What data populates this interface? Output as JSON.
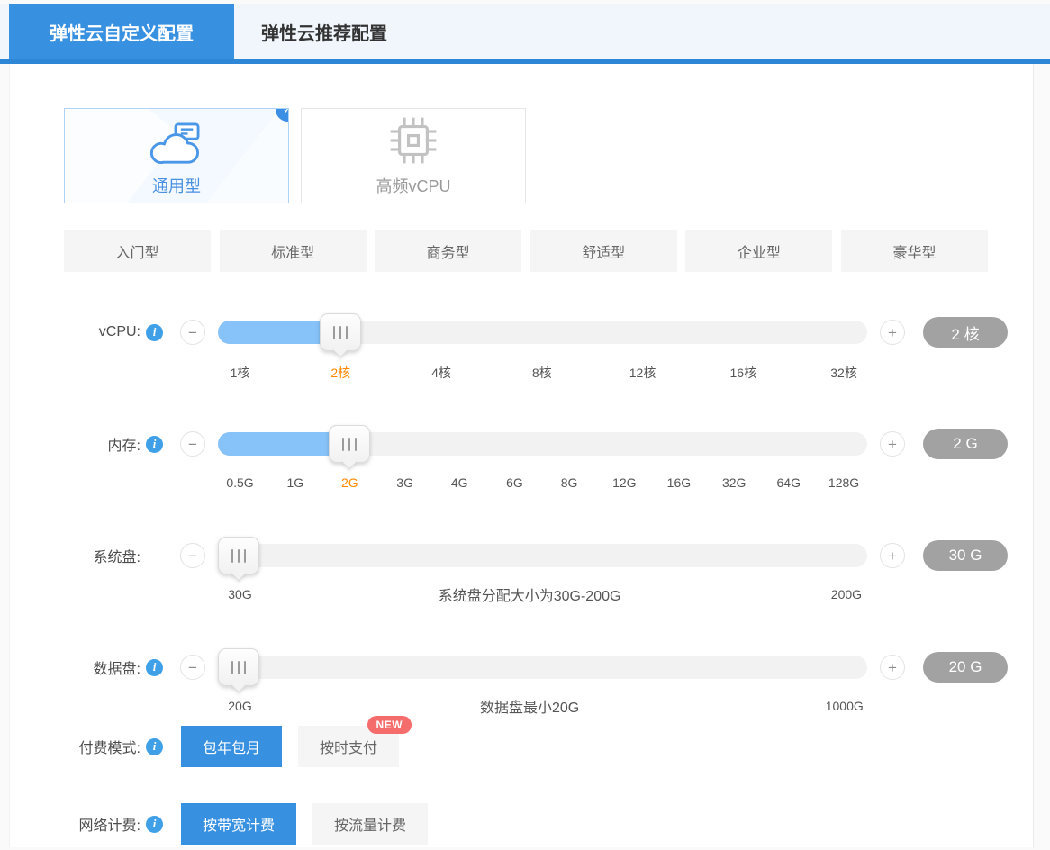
{
  "tabs": [
    {
      "label": "弹性云自定义配置",
      "active": true
    },
    {
      "label": "弹性云推荐配置",
      "active": false
    }
  ],
  "instance_types": [
    {
      "label": "通用型",
      "selected": true,
      "icon": "cloud-server-icon"
    },
    {
      "label": "高频vCPU",
      "selected": false,
      "icon": "cpu-icon"
    }
  ],
  "presets": [
    "入门型",
    "标准型",
    "商务型",
    "舒适型",
    "企业型",
    "豪华型"
  ],
  "sliders": [
    {
      "id": "vcpu",
      "label": "vCPU:",
      "info": true,
      "badge": "2 核",
      "handle_percent": 18.9,
      "fill_percent": 19.5,
      "ticks": [
        {
          "label": "1核",
          "pos": 3.4
        },
        {
          "label": "2核",
          "pos": 18.9,
          "active": true
        },
        {
          "label": "4核",
          "pos": 34.4
        },
        {
          "label": "8核",
          "pos": 49.9
        },
        {
          "label": "12核",
          "pos": 65.4
        },
        {
          "label": "16核",
          "pos": 80.9
        },
        {
          "label": "32核",
          "pos": 96.4
        }
      ]
    },
    {
      "id": "memory",
      "label": "内存:",
      "info": true,
      "badge": "2 G",
      "handle_percent": 20.3,
      "fill_percent": 21,
      "ticks": [
        {
          "label": "0.5G",
          "pos": 3.4
        },
        {
          "label": "1G",
          "pos": 11.9
        },
        {
          "label": "2G",
          "pos": 20.3,
          "active": true
        },
        {
          "label": "3G",
          "pos": 28.8
        },
        {
          "label": "4G",
          "pos": 37.2
        },
        {
          "label": "6G",
          "pos": 45.7
        },
        {
          "label": "8G",
          "pos": 54.1
        },
        {
          "label": "12G",
          "pos": 62.6
        },
        {
          "label": "16G",
          "pos": 71.0
        },
        {
          "label": "32G",
          "pos": 79.5
        },
        {
          "label": "64G",
          "pos": 87.9
        },
        {
          "label": "128G",
          "pos": 96.4
        }
      ]
    },
    {
      "id": "system-disk",
      "label": "系统盘:",
      "info": false,
      "badge": "30 G",
      "handle_percent": 3.2,
      "fill_percent": 4,
      "note": "系统盘分配大小为30G-200G",
      "ticks": [
        {
          "label": "30G",
          "pos": 3.4
        },
        {
          "label": "200G",
          "pos": 96.8
        }
      ]
    },
    {
      "id": "data-disk",
      "label": "数据盘:",
      "info": true,
      "badge": "20 G",
      "handle_percent": 3.2,
      "fill_percent": 4,
      "note": "数据盘最小20G",
      "ticks": [
        {
          "label": "20G",
          "pos": 3.4
        },
        {
          "label": "1000G",
          "pos": 96.5
        }
      ]
    }
  ],
  "payment_mode": {
    "label": "付费模式:",
    "info": true,
    "options": [
      {
        "label": "包年包月",
        "active": true
      },
      {
        "label": "按时支付",
        "active": false,
        "badge": "NEW"
      }
    ]
  },
  "network_billing": {
    "label": "网络计费:",
    "info": true,
    "options": [
      {
        "label": "按带宽计费",
        "active": true
      },
      {
        "label": "按流量计费",
        "active": false
      }
    ]
  },
  "icons": {
    "info": "i",
    "check": "✓",
    "minus": "−",
    "plus": "+"
  },
  "colors": {
    "accent_blue": "#3890E0",
    "tab_underline_blue": "#2E86D6",
    "tab_strip_bg": "#F0F6FB",
    "slider_fill_blue": "#87C3F8",
    "badge_gray": "#A2A2A2",
    "active_tick_orange": "#FF8800",
    "new_badge_red": "#F56C6C",
    "info_icon_blue": "#3FA0E8",
    "selected_card_border": "#ADD2F4"
  }
}
